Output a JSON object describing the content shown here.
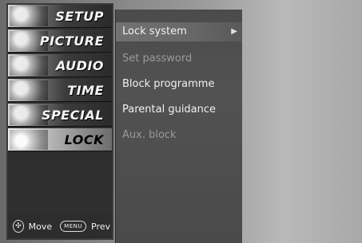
{
  "sidebar": {
    "tabs": [
      {
        "label": "SETUP",
        "icon": "setup-icon"
      },
      {
        "label": "PICTURE",
        "icon": "picture-icon"
      },
      {
        "label": "AUDIO",
        "icon": "audio-icon"
      },
      {
        "label": "TIME",
        "icon": "time-icon"
      },
      {
        "label": "SPECIAL",
        "icon": "special-icon"
      },
      {
        "label": "LOCK",
        "icon": "lock-icon",
        "active": true
      }
    ],
    "footer": {
      "move_label": "Move",
      "prev_label": "Prev",
      "prev_key": "MENU"
    }
  },
  "submenu": {
    "items": [
      {
        "label": "Lock system",
        "state": "selected"
      },
      {
        "label": "Set password",
        "state": "disabled"
      },
      {
        "label": "Block programme",
        "state": "enabled"
      },
      {
        "label": "Parental guidance",
        "state": "enabled"
      },
      {
        "label": "Aux. block",
        "state": "disabled"
      }
    ]
  },
  "colors": {
    "sidebar_bg": "#2d2d2d",
    "submenu_bg": "#4b4b4b",
    "highlight": "#6a6a6a",
    "text": "#f1f1f1",
    "disabled_text": "#9a9a9a"
  }
}
